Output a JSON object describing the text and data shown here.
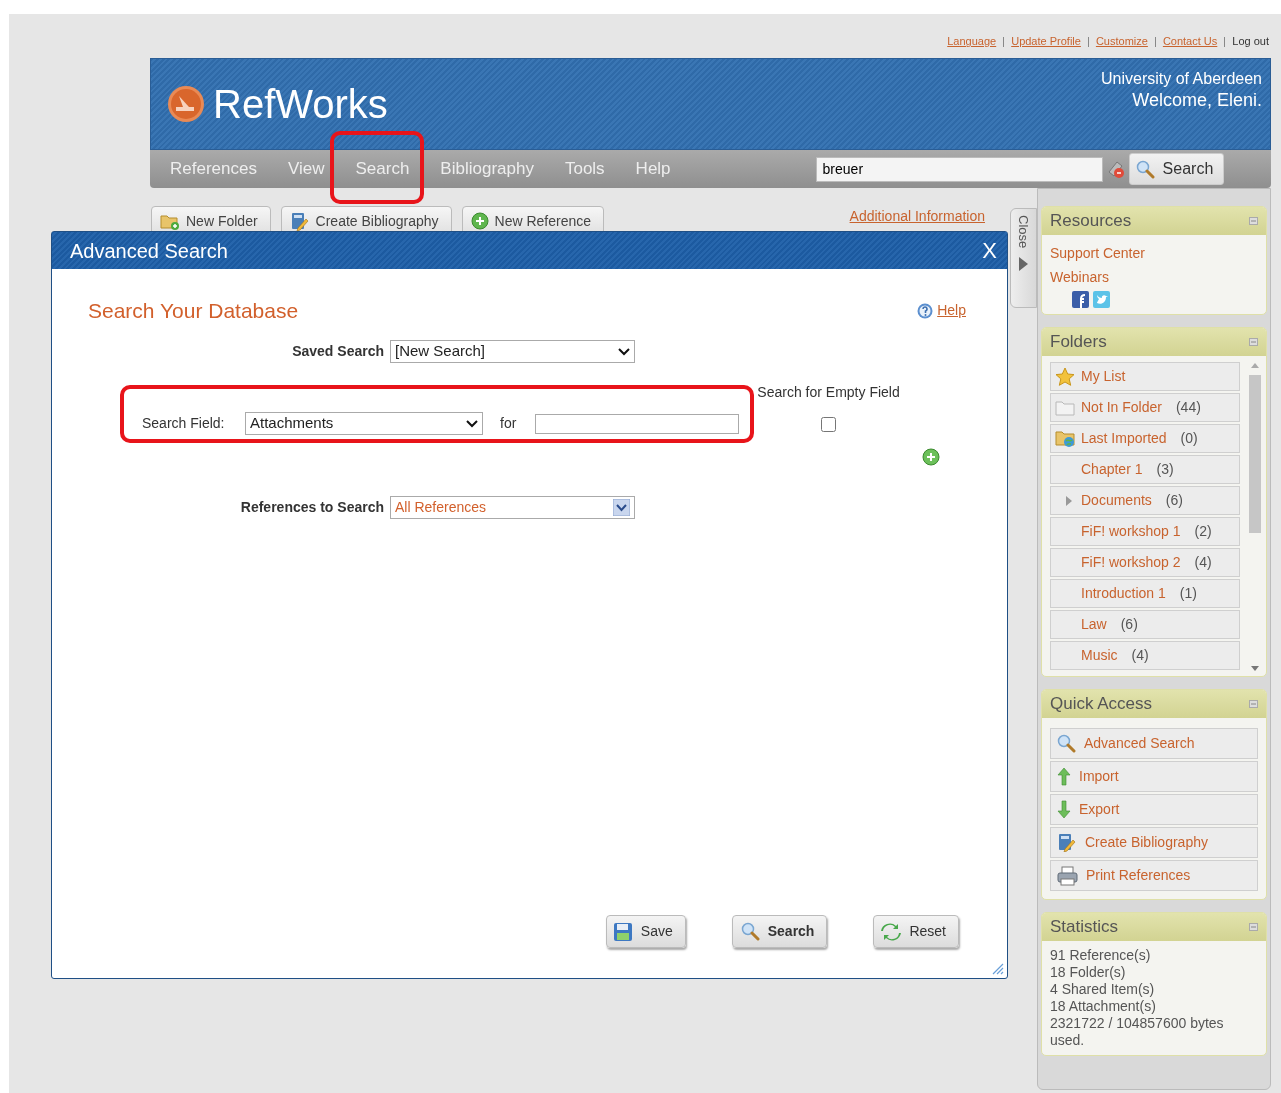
{
  "top_links": [
    {
      "label": "Language",
      "kind": "link"
    },
    {
      "label": "Update Profile",
      "kind": "link"
    },
    {
      "label": "Customize",
      "kind": "link"
    },
    {
      "label": "Contact Us",
      "kind": "link"
    },
    {
      "label": "Log out",
      "kind": "text"
    }
  ],
  "header": {
    "logo": "RefWorks",
    "institution": "University of Aberdeen",
    "welcome": "Welcome, Eleni."
  },
  "nav": {
    "items": [
      "References",
      "View",
      "Search",
      "Bibliography",
      "Tools",
      "Help"
    ],
    "search": {
      "value": "breuer",
      "button": "Search"
    }
  },
  "toolbar": {
    "buttons": [
      {
        "label": "New Folder",
        "kind": "folder"
      },
      {
        "label": "Create Bibliography",
        "kind": "bibliography"
      },
      {
        "label": "New Reference",
        "kind": "add"
      }
    ],
    "link": "Additional Information"
  },
  "close_tab": {
    "label": "Close"
  },
  "dialog": {
    "title": "Advanced Search",
    "close": "X",
    "heading": "Search Your Database",
    "help": "Help",
    "saved_search": {
      "label": "Saved Search",
      "value": "[New Search]"
    },
    "search_field": {
      "label": "Search Field:",
      "value": "Attachments",
      "for_label": "for",
      "empty_field_label": "Search for Empty Field",
      "empty_field_checked": false
    },
    "references_to_search": {
      "label": "References to Search",
      "value": "All References"
    },
    "buttons": [
      {
        "label": "Save",
        "kind": "save"
      },
      {
        "label": "Search",
        "kind": "search"
      },
      {
        "label": "Reset",
        "kind": "reset"
      }
    ]
  },
  "sidebar": {
    "resources": {
      "title": "Resources",
      "links": [
        "Support Center",
        "Webinars"
      ]
    },
    "folders": {
      "title": "Folders",
      "items": [
        {
          "name": "My List",
          "kind": "favorites"
        },
        {
          "name": "Not In Folder",
          "count": "(44)",
          "kind": "unfiled"
        },
        {
          "name": "Last Imported",
          "count": "(0)",
          "kind": "imported"
        },
        {
          "name": "Chapter 1",
          "count": "(3)",
          "kind": "folder"
        },
        {
          "name": "Documents",
          "count": "(6)",
          "kind": "parent"
        },
        {
          "name": "FiF! workshop 1",
          "count": "(2)",
          "kind": "folder"
        },
        {
          "name": "FiF! workshop 2",
          "count": "(4)",
          "kind": "folder"
        },
        {
          "name": "Introduction 1",
          "count": "(1)",
          "kind": "folder"
        },
        {
          "name": "Law",
          "count": "(6)",
          "kind": "folder"
        },
        {
          "name": "Music",
          "count": "(4)",
          "kind": "folder"
        }
      ]
    },
    "quick_access": {
      "title": "Quick Access",
      "items": [
        {
          "label": "Advanced Search",
          "kind": "search"
        },
        {
          "label": "Import",
          "kind": "import"
        },
        {
          "label": "Export",
          "kind": "export"
        },
        {
          "label": "Create Bibliography",
          "kind": "bibliography"
        },
        {
          "label": "Print References",
          "kind": "print"
        }
      ]
    },
    "statistics": {
      "title": "Statistics",
      "lines": [
        "91 Reference(s)",
        "18 Folder(s)",
        "4 Shared Item(s)",
        "18 Attachment(s)",
        "2321722 / 104857600 bytes used."
      ]
    }
  }
}
